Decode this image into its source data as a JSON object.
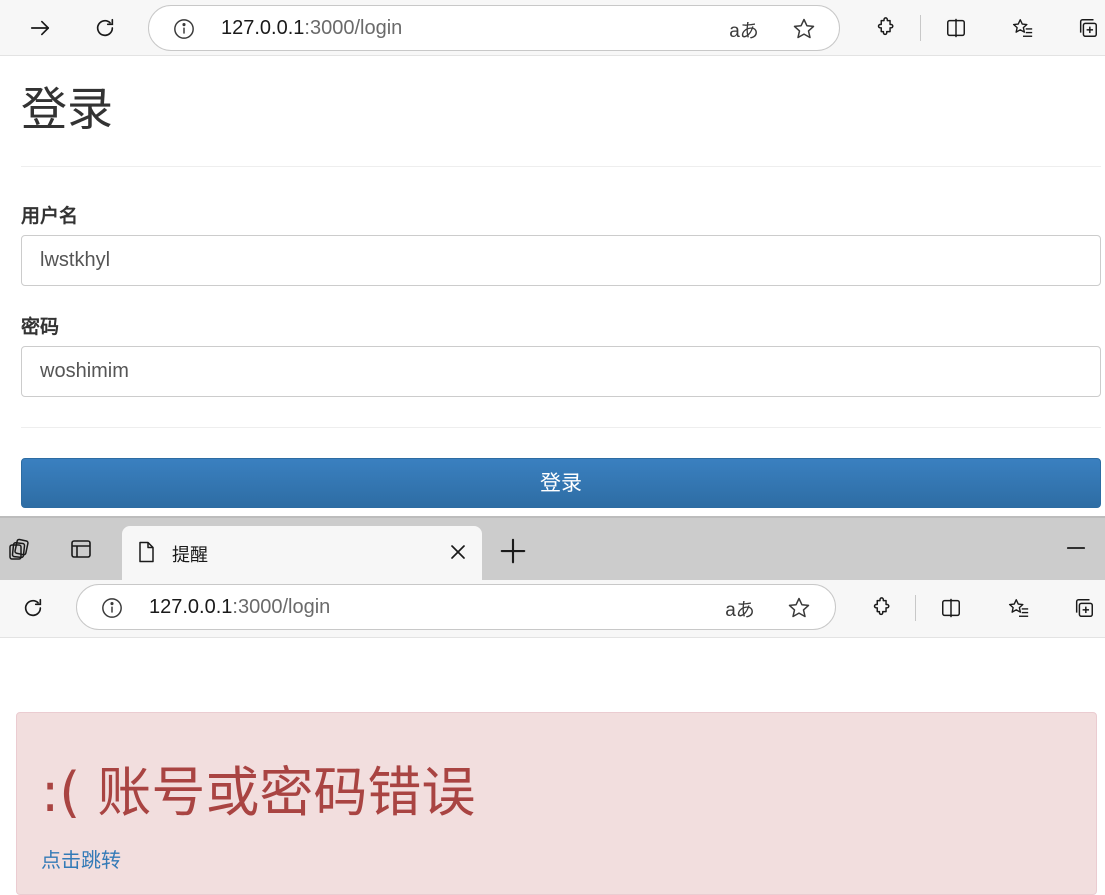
{
  "top_window": {
    "url_host": "127.0.0.1",
    "url_path": ":3000/login",
    "read_aloud_label": "aあ"
  },
  "login_page": {
    "title": "登录",
    "username_label": "用户名",
    "username_value": "lwstkhyl",
    "password_label": "密码",
    "password_value": "woshimim",
    "submit_label": "登录",
    "submit_color": "#337ab7"
  },
  "bottom_window": {
    "tab_title": "提醒",
    "url_host": "127.0.0.1",
    "url_path": ":3000/login",
    "read_aloud_label": "aあ"
  },
  "alert_page": {
    "heading": ":( 账号或密码错误",
    "link_text": "点击跳转",
    "alert_bg": "#f2dede",
    "alert_text_color": "#a94442"
  },
  "icons": {
    "toolbar": [
      "forward-icon",
      "refresh-icon",
      "info-icon",
      "read-aloud-icon",
      "favorite-star-icon",
      "extensions-icon",
      "split-screen-icon",
      "favorites-icon",
      "collections-icon"
    ],
    "tabstrip": [
      "workspaces-icon",
      "tab-actions-icon",
      "page-icon",
      "close-icon",
      "new-tab-icon",
      "minimize-icon"
    ]
  }
}
